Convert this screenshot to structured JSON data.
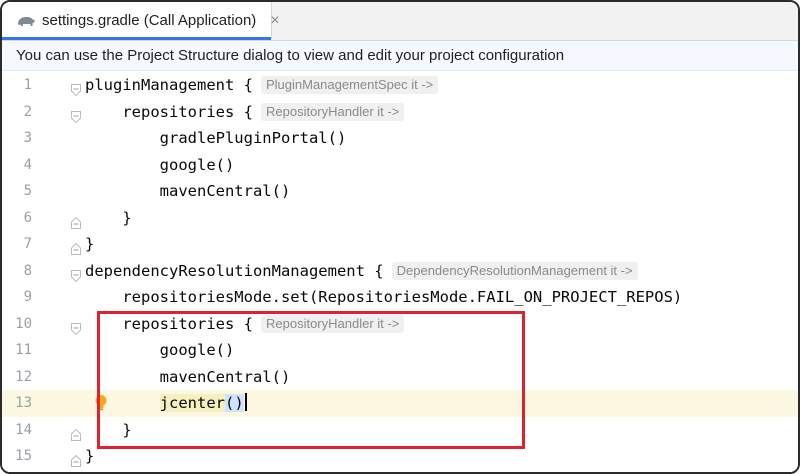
{
  "tab": {
    "title": "settings.gradle (Call Application)",
    "close_glyph": "×",
    "icon": "gradle-elephant-icon"
  },
  "banner": {
    "text": "You can use the Project Structure dialog to view and edit your project configuration"
  },
  "editor": {
    "lines": [
      {
        "num": "1",
        "code": "pluginManagement {",
        "hint": "PluginManagementSpec it ->",
        "fold": "open"
      },
      {
        "num": "2",
        "code": "    repositories {",
        "hint": "RepositoryHandler it ->",
        "fold": "open"
      },
      {
        "num": "3",
        "code": "        gradlePluginPortal()",
        "hint": "",
        "fold": ""
      },
      {
        "num": "4",
        "code": "        google()",
        "hint": "",
        "fold": ""
      },
      {
        "num": "5",
        "code": "        mavenCentral()",
        "hint": "",
        "fold": ""
      },
      {
        "num": "6",
        "code": "    }",
        "hint": "",
        "fold": "close"
      },
      {
        "num": "7",
        "code": "}",
        "hint": "",
        "fold": "close"
      },
      {
        "num": "8",
        "code": "dependencyResolutionManagement {",
        "hint": "DependencyResolutionManagement it ->",
        "fold": "open"
      },
      {
        "num": "9",
        "code": "    repositoriesMode.set(RepositoriesMode.FAIL_ON_PROJECT_REPOS)",
        "hint": "",
        "fold": ""
      },
      {
        "num": "10",
        "code": "    repositories {",
        "hint": "RepositoryHandler it ->",
        "fold": "open"
      },
      {
        "num": "11",
        "code": "        google()",
        "hint": "",
        "fold": ""
      },
      {
        "num": "12",
        "code": "        mavenCentral()",
        "hint": "",
        "fold": ""
      },
      {
        "num": "13",
        "code": "        jcenter()",
        "hint": "",
        "fold": "",
        "current": true
      },
      {
        "num": "14",
        "code": "    }",
        "hint": "",
        "fold": "close"
      },
      {
        "num": "15",
        "code": "}",
        "hint": "",
        "fold": "close"
      }
    ],
    "current_line_parts": {
      "indent": "        ",
      "ident": "jcenter",
      "parens": "()"
    },
    "intention_icon": "lightbulb-icon",
    "highlight_box_color": "#e0222c"
  }
}
